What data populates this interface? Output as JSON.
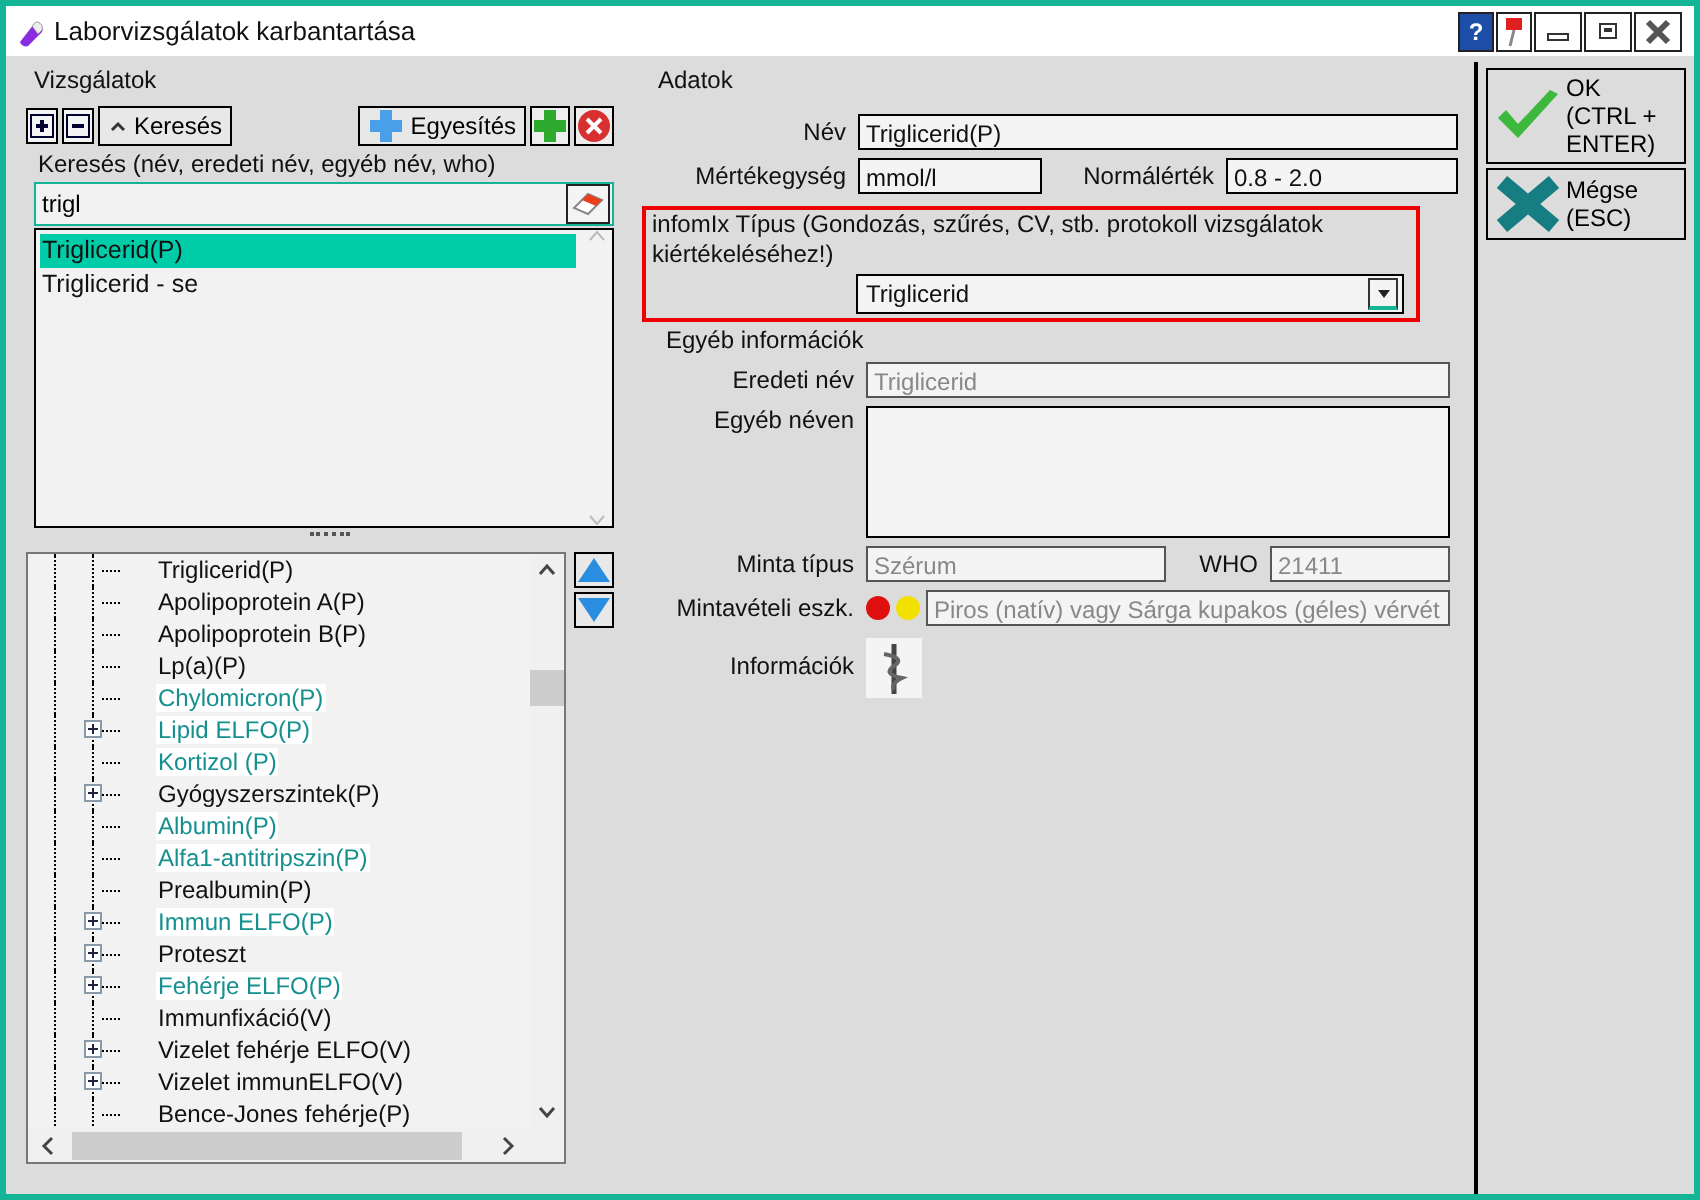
{
  "window": {
    "title": "Laborvizsgálatok karbantartása",
    "buttons": [
      "?"
    ]
  },
  "left": {
    "title": "Vizsgálatok",
    "toolbar": {
      "search_toggle": "Keresés",
      "merge": "Egyesítés"
    },
    "search_label": "Keresés (név, eredeti név, egyéb név, who)",
    "search_value": "trigl",
    "results": [
      {
        "label": "Triglicerid(P)",
        "selected": true
      },
      {
        "label": "Triglicerid - se",
        "selected": false
      }
    ],
    "tree": [
      {
        "label": "Triglicerid(P)",
        "highlighted": false,
        "expandable": false
      },
      {
        "label": "Apolipoprotein A(P)",
        "highlighted": false,
        "expandable": false
      },
      {
        "label": "Apolipoprotein B(P)",
        "highlighted": false,
        "expandable": false
      },
      {
        "label": "Lp(a)(P)",
        "highlighted": false,
        "expandable": false
      },
      {
        "label": "Chylomicron(P)",
        "highlighted": true,
        "expandable": false
      },
      {
        "label": "Lipid ELFO(P)",
        "highlighted": true,
        "expandable": true
      },
      {
        "label": "Kortizol (P)",
        "highlighted": true,
        "expandable": false
      },
      {
        "label": "Gyógyszerszintek(P)",
        "highlighted": false,
        "expandable": true
      },
      {
        "label": "Albumin(P)",
        "highlighted": true,
        "expandable": false
      },
      {
        "label": "Alfa1-antitripszin(P)",
        "highlighted": true,
        "expandable": false
      },
      {
        "label": "Prealbumin(P)",
        "highlighted": false,
        "expandable": false
      },
      {
        "label": "Immun ELFO(P)",
        "highlighted": true,
        "expandable": true
      },
      {
        "label": "Proteszt",
        "highlighted": false,
        "expandable": true
      },
      {
        "label": "Fehérje ELFO(P)",
        "highlighted": true,
        "expandable": true
      },
      {
        "label": "Immunfixáció(V)",
        "highlighted": false,
        "expandable": false
      },
      {
        "label": "Vizelet fehérje ELFO(V)",
        "highlighted": false,
        "expandable": true
      },
      {
        "label": "Vizelet immunELFO(V)",
        "highlighted": false,
        "expandable": true
      },
      {
        "label": "Bence-Jones fehérje(P)",
        "highlighted": false,
        "expandable": false
      }
    ]
  },
  "data": {
    "title": "Adatok",
    "name_label": "Név",
    "name": "Triglicerid(P)",
    "unit_label": "Mértékegység",
    "unit": "mmol/l",
    "normal_label": "Normálérték",
    "normal": "0.8 - 2.0",
    "type_label": "infomIx Típus (Gondozás, szűrés, CV, stb. protokoll vizsgálatok kiértékeléséhez!)",
    "type": "Triglicerid"
  },
  "other": {
    "title": "Egyéb információk",
    "original_label": "Eredeti név",
    "original": "Triglicerid",
    "alias_label": "Egyéb néven",
    "sample_label": "Minta típus",
    "sample": "Szérum",
    "who_label": "WHO",
    "who": "21411",
    "device_label": "Mintavételi eszk.",
    "caps": [
      {
        "color": "#e01010"
      },
      {
        "color": "#f2e000"
      }
    ],
    "device": "Piros (natív) vagy Sárga kupakos (géles) vérvét",
    "info_label": "Információk"
  },
  "actions": [
    {
      "kind": "ok",
      "label": "OK\n(CTRL +\nENTER)"
    },
    {
      "kind": "cancel",
      "label": "Mégse\n(ESC)"
    }
  ]
}
